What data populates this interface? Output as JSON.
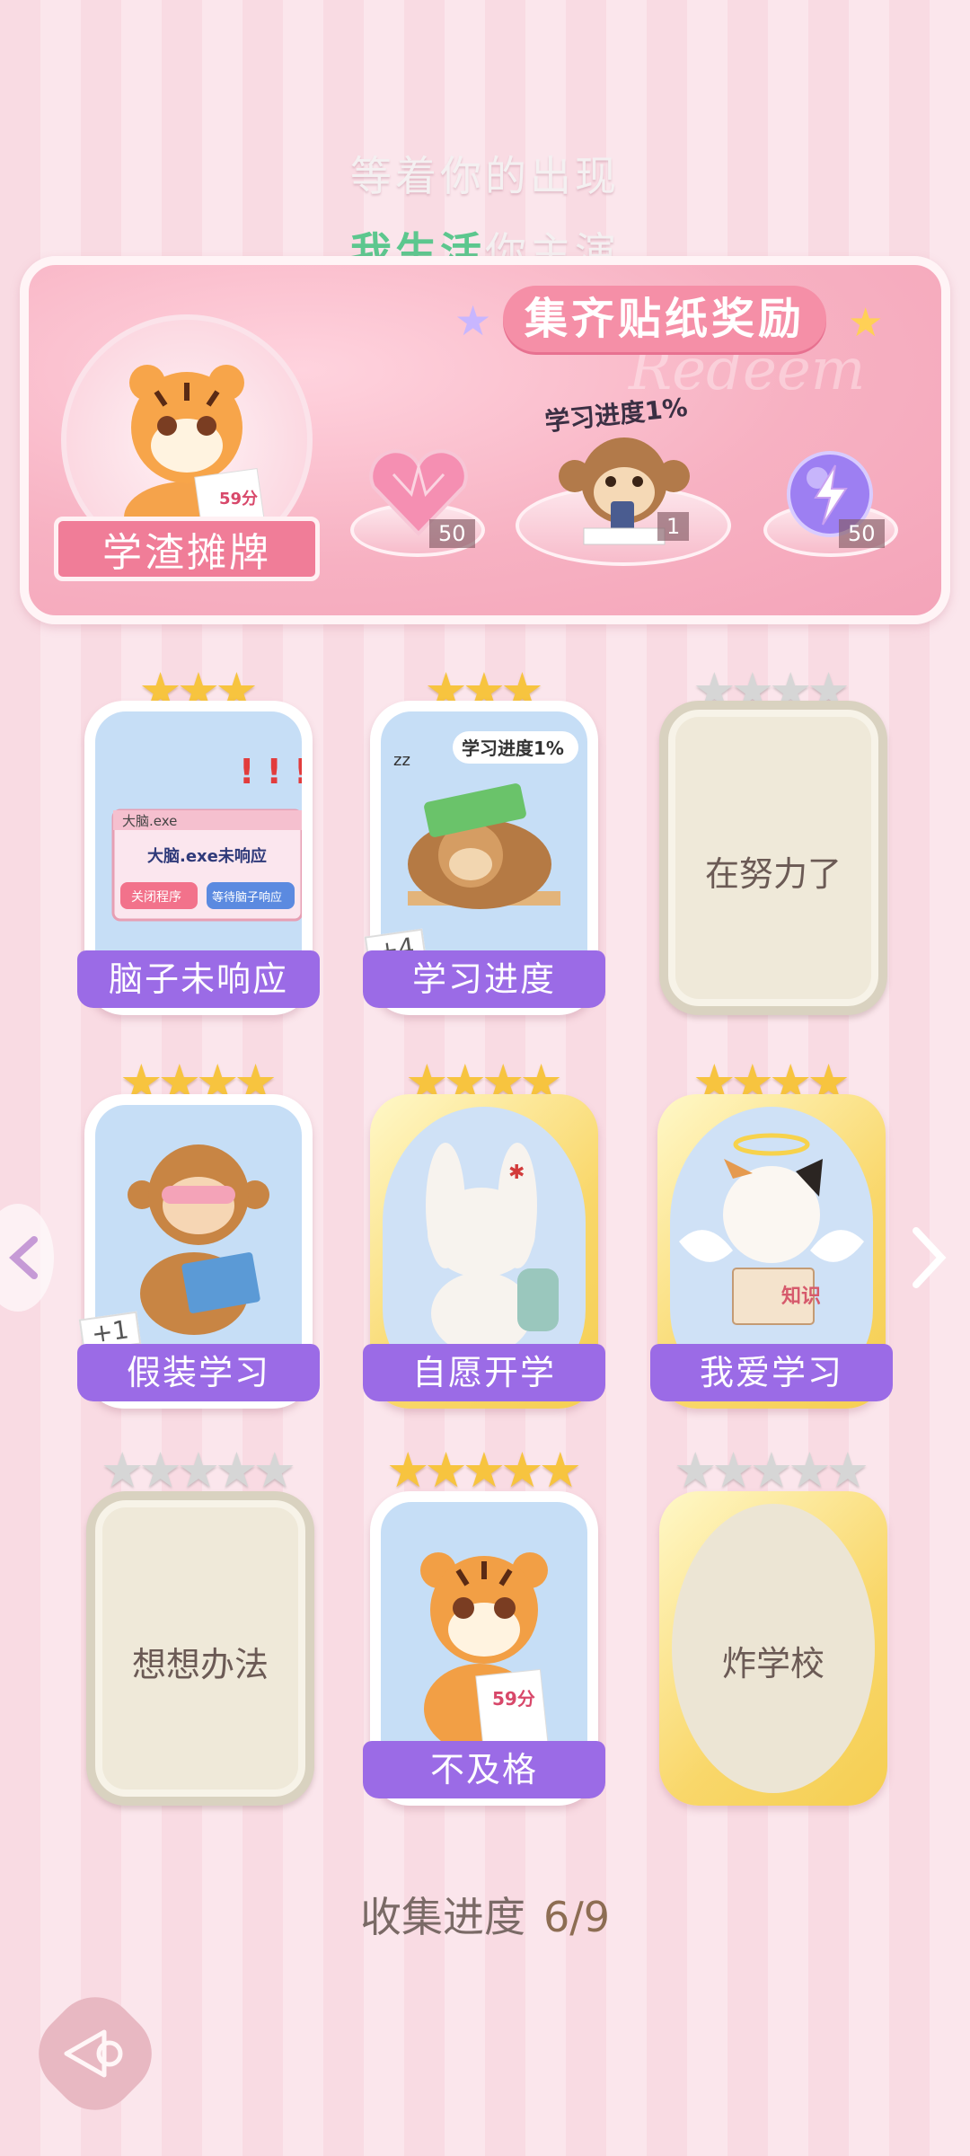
{
  "header": {
    "slogan_line1": "等着你的出现",
    "slogan_line2_green": "我生活",
    "slogan_line2_rest": "你主演"
  },
  "banner": {
    "title": "集齐贴纸奖励",
    "watermark": "Redeem",
    "main_reward_label": "学渣摊牌",
    "main_reward_paper": "59分",
    "rewards": [
      {
        "icon": "pink-heart-gem-icon",
        "count": "50"
      },
      {
        "icon": "monkey-phone-sticker",
        "label": "学习进度1%",
        "count": "1"
      },
      {
        "icon": "lightning-orb-icon",
        "count": "50"
      }
    ]
  },
  "cards": [
    {
      "label": "脑子未响应",
      "stars": 3,
      "max_stars": 3,
      "unlocked": true,
      "badge": "",
      "popup_title": "大脑.exe",
      "popup_msg": "大脑.exe未响应",
      "popup_btn1": "关闭程序",
      "popup_btn2": "等待脑子响应"
    },
    {
      "label": "学习进度",
      "stars": 3,
      "max_stars": 3,
      "unlocked": true,
      "badge": "+4",
      "bubble": "学习进度1%"
    },
    {
      "label": "在努力了",
      "stars": 0,
      "max_stars": 4,
      "unlocked": false
    },
    {
      "label": "假装学习",
      "stars": 4,
      "max_stars": 4,
      "unlocked": true,
      "badge": "+1"
    },
    {
      "label": "自愿开学",
      "stars": 4,
      "max_stars": 4,
      "unlocked": true,
      "badge": ""
    },
    {
      "label": "我爱学习",
      "stars": 4,
      "max_stars": 4,
      "unlocked": true,
      "badge": "",
      "book_text": "知识"
    },
    {
      "label": "想想办法",
      "stars": 0,
      "max_stars": 5,
      "unlocked": false
    },
    {
      "label": "不及格",
      "stars": 5,
      "max_stars": 5,
      "unlocked": true,
      "badge": "",
      "paper": "59分"
    },
    {
      "label": "炸学校",
      "stars": 0,
      "max_stars": 5,
      "unlocked": false
    }
  ],
  "collection": {
    "label": "收集进度",
    "value": "6/9"
  },
  "colors": {
    "accent_pink": "#f58fa7",
    "label_purple": "#9b6be6",
    "star_gold": "#f7c43f",
    "star_silver": "#d6d6d6"
  }
}
